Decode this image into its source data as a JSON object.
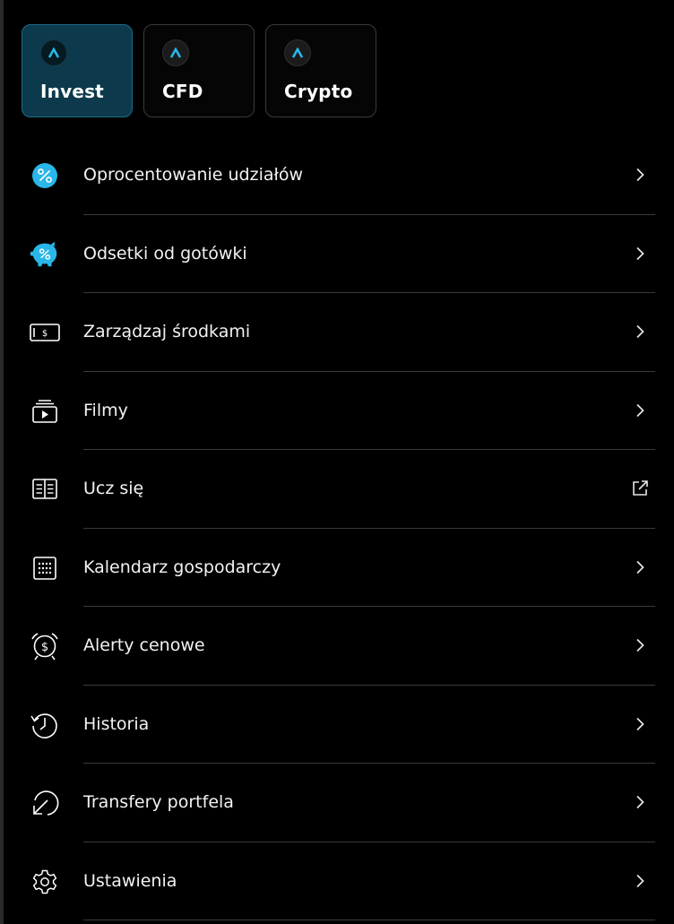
{
  "tabs": [
    {
      "label": "Invest",
      "active": true
    },
    {
      "label": "CFD",
      "active": false
    },
    {
      "label": "Crypto",
      "active": false
    }
  ],
  "menu": {
    "items": [
      {
        "label": "Oprocentowanie udziałów",
        "icon": "percent-circle-icon",
        "action": "chevron-right-icon"
      },
      {
        "label": "Odsetki od gotówki",
        "icon": "piggy-bank-icon",
        "action": "chevron-right-icon"
      },
      {
        "label": "Zarządzaj środkami",
        "icon": "banknote-icon",
        "action": "chevron-right-icon"
      },
      {
        "label": "Filmy",
        "icon": "video-icon",
        "action": "chevron-right-icon"
      },
      {
        "label": "Ucz się",
        "icon": "book-icon",
        "action": "external-link-icon"
      },
      {
        "label": "Kalendarz gospodarczy",
        "icon": "calendar-icon",
        "action": "chevron-right-icon"
      },
      {
        "label": "Alerty cenowe",
        "icon": "price-alert-icon",
        "action": "chevron-right-icon"
      },
      {
        "label": "Historia",
        "icon": "history-icon",
        "action": "chevron-right-icon"
      },
      {
        "label": "Transfery portfela",
        "icon": "transfer-icon",
        "action": "chevron-right-icon"
      },
      {
        "label": "Ustawienia",
        "icon": "gear-icon",
        "action": "chevron-right-icon"
      }
    ]
  },
  "colors": {
    "background": "#000000",
    "accent": "#29b6e8",
    "active_tab_bg": "#0c3a4c",
    "divider": "#3a3a3a"
  }
}
